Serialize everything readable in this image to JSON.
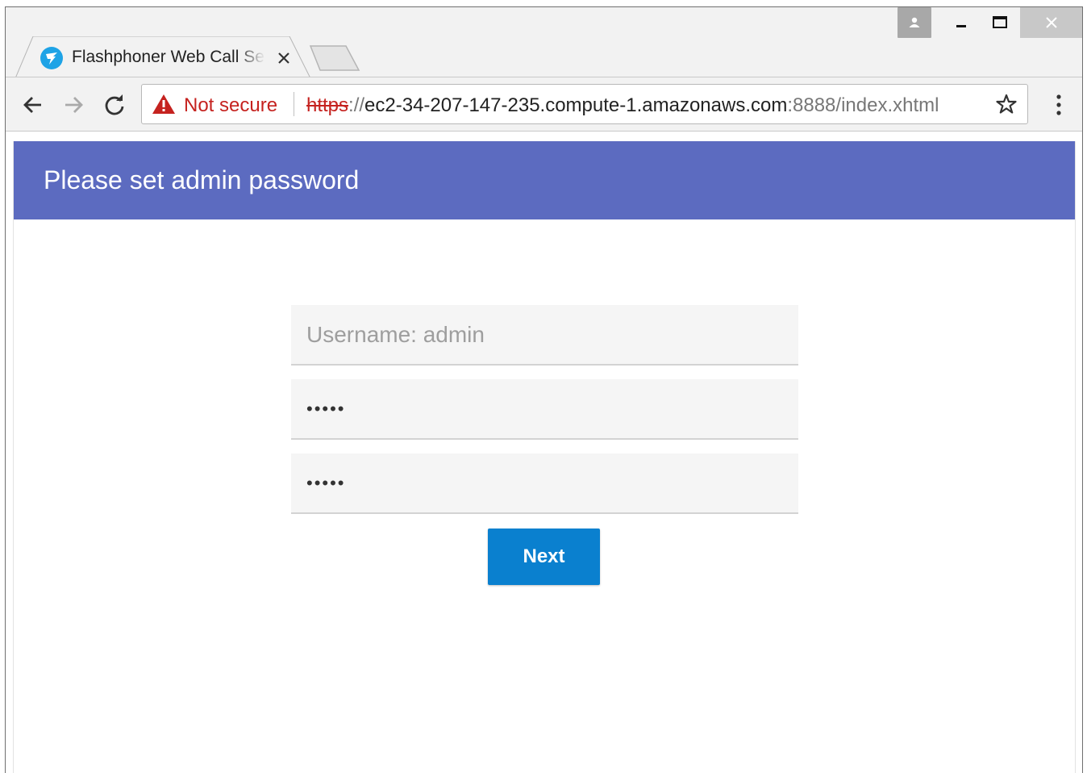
{
  "browser": {
    "tab_title": "Flashphoner Web Call Server",
    "security_label": "Not secure",
    "url": {
      "scheme": "https",
      "separator": "://",
      "host": "ec2-34-207-147-235.compute-1.amazonaws.com",
      "path": ":8888/index.xhtml"
    }
  },
  "page": {
    "heading": "Please set admin password",
    "form": {
      "username_placeholder": "Username: admin",
      "password_value": "•••••",
      "confirm_value": "•••••",
      "next_label": "Next"
    }
  },
  "colors": {
    "header_bg": "#5c6bc0",
    "button_bg": "#0a80cf",
    "warning_red": "#c5221f",
    "favicon": "#1ea3e6"
  },
  "icons": [
    "profile-icon",
    "minimize-icon",
    "maximize-icon",
    "close-icon",
    "back-arrow-icon",
    "forward-arrow-icon",
    "reload-icon",
    "warning-triangle-icon",
    "star-icon",
    "kebab-menu-icon"
  ]
}
